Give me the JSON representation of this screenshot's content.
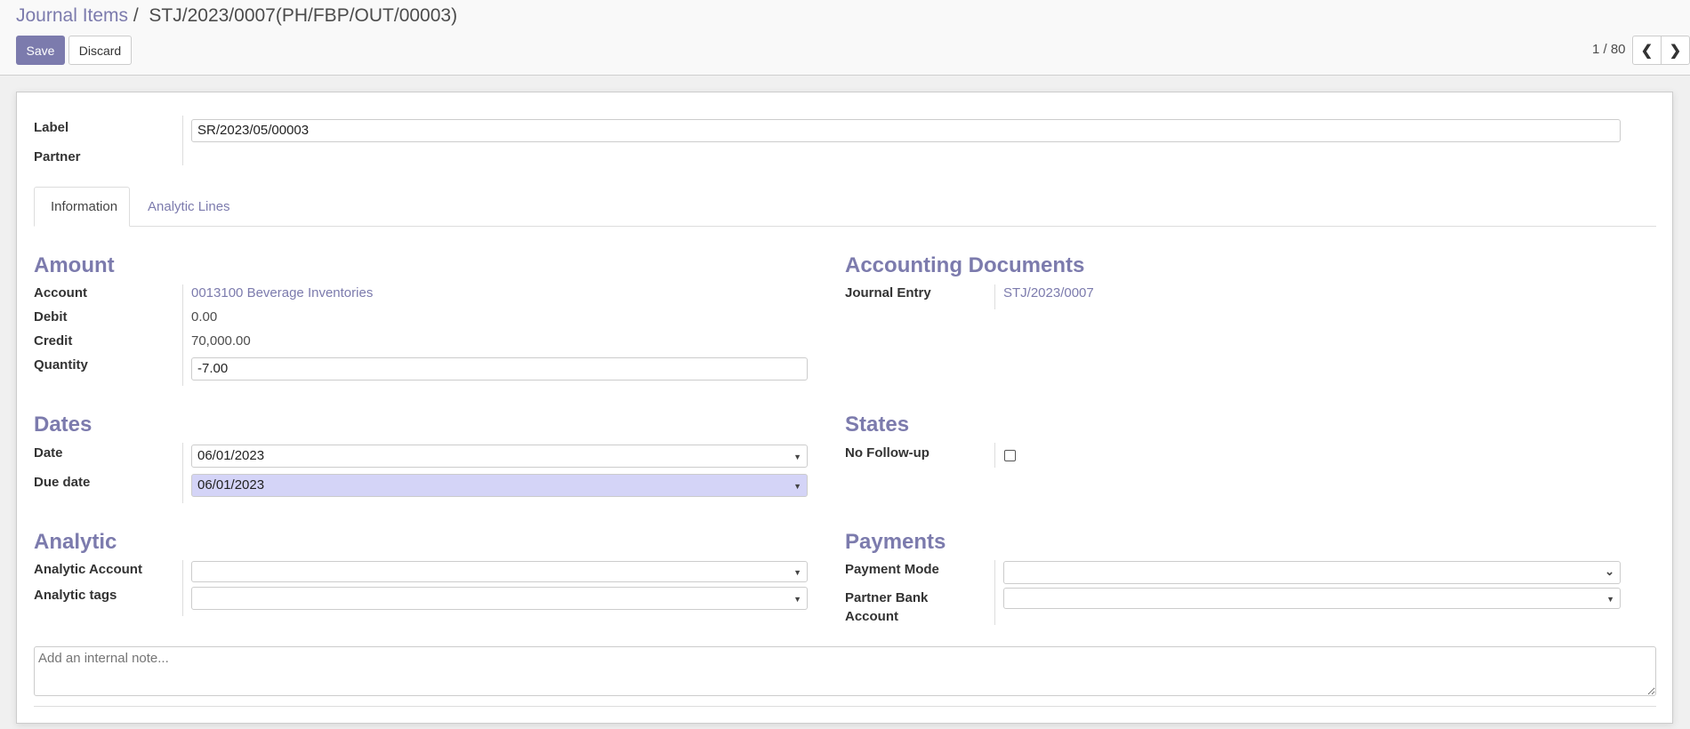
{
  "breadcrumb": {
    "parent": "Journal Items",
    "separator": "/",
    "current": "STJ/2023/0007(PH/FBP/OUT/00003)"
  },
  "toolbar": {
    "save": "Save",
    "discard": "Discard"
  },
  "pager": {
    "text": "1 / 80",
    "prev_icon": "chevron-left-icon",
    "next_icon": "chevron-right-icon"
  },
  "form": {
    "label": {
      "label": "Label",
      "value": "SR/2023/05/00003"
    },
    "partner": {
      "label": "Partner",
      "value": ""
    },
    "tabs": [
      {
        "label": "Information",
        "active": true
      },
      {
        "label": "Analytic Lines",
        "active": false
      }
    ],
    "amount": {
      "title": "Amount",
      "account_label": "Account",
      "account": "0013100 Beverage Inventories",
      "debit_label": "Debit",
      "debit": "0.00",
      "credit_label": "Credit",
      "credit": "70,000.00",
      "quantity_label": "Quantity",
      "quantity": "-7.00"
    },
    "docs": {
      "title": "Accounting Documents",
      "journal_entry_label": "Journal Entry",
      "journal_entry": "STJ/2023/0007"
    },
    "dates": {
      "title": "Dates",
      "date_label": "Date",
      "date": "06/01/2023",
      "due_label": "Due date",
      "due": "06/01/2023"
    },
    "states": {
      "title": "States",
      "no_followup_label": "No Follow-up",
      "no_followup": false
    },
    "analytic": {
      "title": "Analytic",
      "account_label": "Analytic Account",
      "account": "",
      "tags_label": "Analytic tags",
      "tags": ""
    },
    "payments": {
      "title": "Payments",
      "mode_label": "Payment Mode",
      "mode": "",
      "bank_label": "Partner Bank Account",
      "bank": ""
    },
    "note": {
      "placeholder": "Add an internal note...",
      "value": ""
    }
  },
  "colors": {
    "accent": "#7c7bad",
    "highlight": "#d4d4f7"
  }
}
